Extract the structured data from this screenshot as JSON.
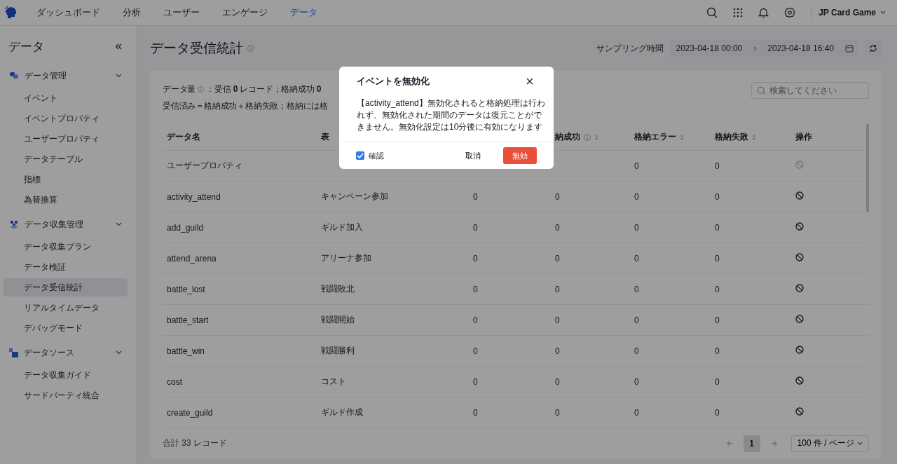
{
  "nav": {
    "items": [
      {
        "label": "ダッシュボード",
        "selected": false
      },
      {
        "label": "分析",
        "selected": false
      },
      {
        "label": "ユーザー",
        "selected": false
      },
      {
        "label": "エンゲージ",
        "selected": false
      },
      {
        "label": "データ",
        "selected": true
      }
    ],
    "project": "JP Card Game"
  },
  "sidebar": {
    "title": "データ",
    "groups": [
      {
        "label": "データ管理",
        "kind": "cubes",
        "expanded": true,
        "children": [
          {
            "label": "イベント",
            "selected": false
          },
          {
            "label": "イベントプロパティ",
            "selected": false
          },
          {
            "label": "ユーザープロパティ",
            "selected": false
          },
          {
            "label": "データテーブル",
            "selected": false
          },
          {
            "label": "指標",
            "selected": false
          },
          {
            "label": "為替換算",
            "selected": false
          }
        ]
      },
      {
        "label": "データ収集管理",
        "kind": "dots",
        "expanded": true,
        "children": [
          {
            "label": "データ収集プラン",
            "selected": false
          },
          {
            "label": "データ検証",
            "selected": false
          },
          {
            "label": "データ受信統計",
            "selected": true
          },
          {
            "label": "リアルタイムデータ",
            "selected": false
          },
          {
            "label": "デバッグモード",
            "selected": false
          }
        ]
      },
      {
        "label": "データソース",
        "kind": "squares",
        "expanded": true,
        "children": [
          {
            "label": "データ収集ガイド",
            "selected": false
          },
          {
            "label": "サードパーティ統合",
            "selected": false
          }
        ]
      }
    ]
  },
  "page": {
    "title": "データ受信統計",
    "sampling_label": "サンプリング時間",
    "date_from": "2023-04-18 00:00",
    "date_to": "2023-04-18 16:40",
    "separator": "›"
  },
  "summary": {
    "label": "データ量",
    "line_1": "：受信 **0** レコード；格納成功 **0**",
    "line_2": "受信済み＝格納成功＋格納失敗；格納には格"
  },
  "search": {
    "placeholder": "検索してください"
  },
  "table": {
    "columns": [
      {
        "label": "データ名",
        "kind": "plain"
      },
      {
        "label": "表",
        "kind": "plain"
      },
      {
        "kind": "blank"
      },
      {
        "label": "納成功",
        "kind": "info_sortable"
      },
      {
        "label": "格納エラー",
        "kind": "sortable"
      },
      {
        "label": "格納失敗",
        "kind": "sortable"
      },
      {
        "label": "操作",
        "kind": "plain"
      }
    ],
    "rows": [
      {
        "cells": [
          "ユーザープロパティ",
          null,
          null,
          null,
          "0",
          "0"
        ],
        "disabled": true
      },
      {
        "cells": [
          "activity_attend",
          "キャンペーン参加",
          "0",
          "0",
          "0",
          "0"
        ],
        "disabled": false
      },
      {
        "cells": [
          "add_guild",
          "ギルド加入",
          "0",
          "0",
          "0",
          "0"
        ],
        "disabled": false
      },
      {
        "cells": [
          "attend_arena",
          "アリーナ参加",
          "0",
          "0",
          "0",
          "0"
        ],
        "disabled": false
      },
      {
        "cells": [
          "battle_lost",
          "戦闘敗北",
          "0",
          "0",
          "0",
          "0"
        ],
        "disabled": false
      },
      {
        "cells": [
          "battle_start",
          "戦闘開始",
          "0",
          "0",
          "0",
          "0"
        ],
        "disabled": false
      },
      {
        "cells": [
          "battle_win",
          "戦闘勝利",
          "0",
          "0",
          "0",
          "0"
        ],
        "disabled": false
      },
      {
        "cells": [
          "cost",
          "コスト",
          "0",
          "0",
          "0",
          "0"
        ],
        "disabled": false
      },
      {
        "cells": [
          "create_guild",
          "ギルド作成",
          "0",
          "0",
          "0",
          "0"
        ],
        "disabled": false
      }
    ]
  },
  "footer": {
    "total": "合計 33 レコード",
    "pages": [
      {
        "label": "1",
        "selected": true
      }
    ],
    "page_size": "100 件 / ページ"
  },
  "dialog": {
    "title": "イベントを無効化",
    "message": "【activity_attend】無効化されると格納処理は行われず、無効化された期間のデータは復元ことができません。無効化設定は10分後に有効になります",
    "confirm": {
      "label": "確認",
      "checked": true
    },
    "cancel": "取消",
    "ok": "無効"
  }
}
